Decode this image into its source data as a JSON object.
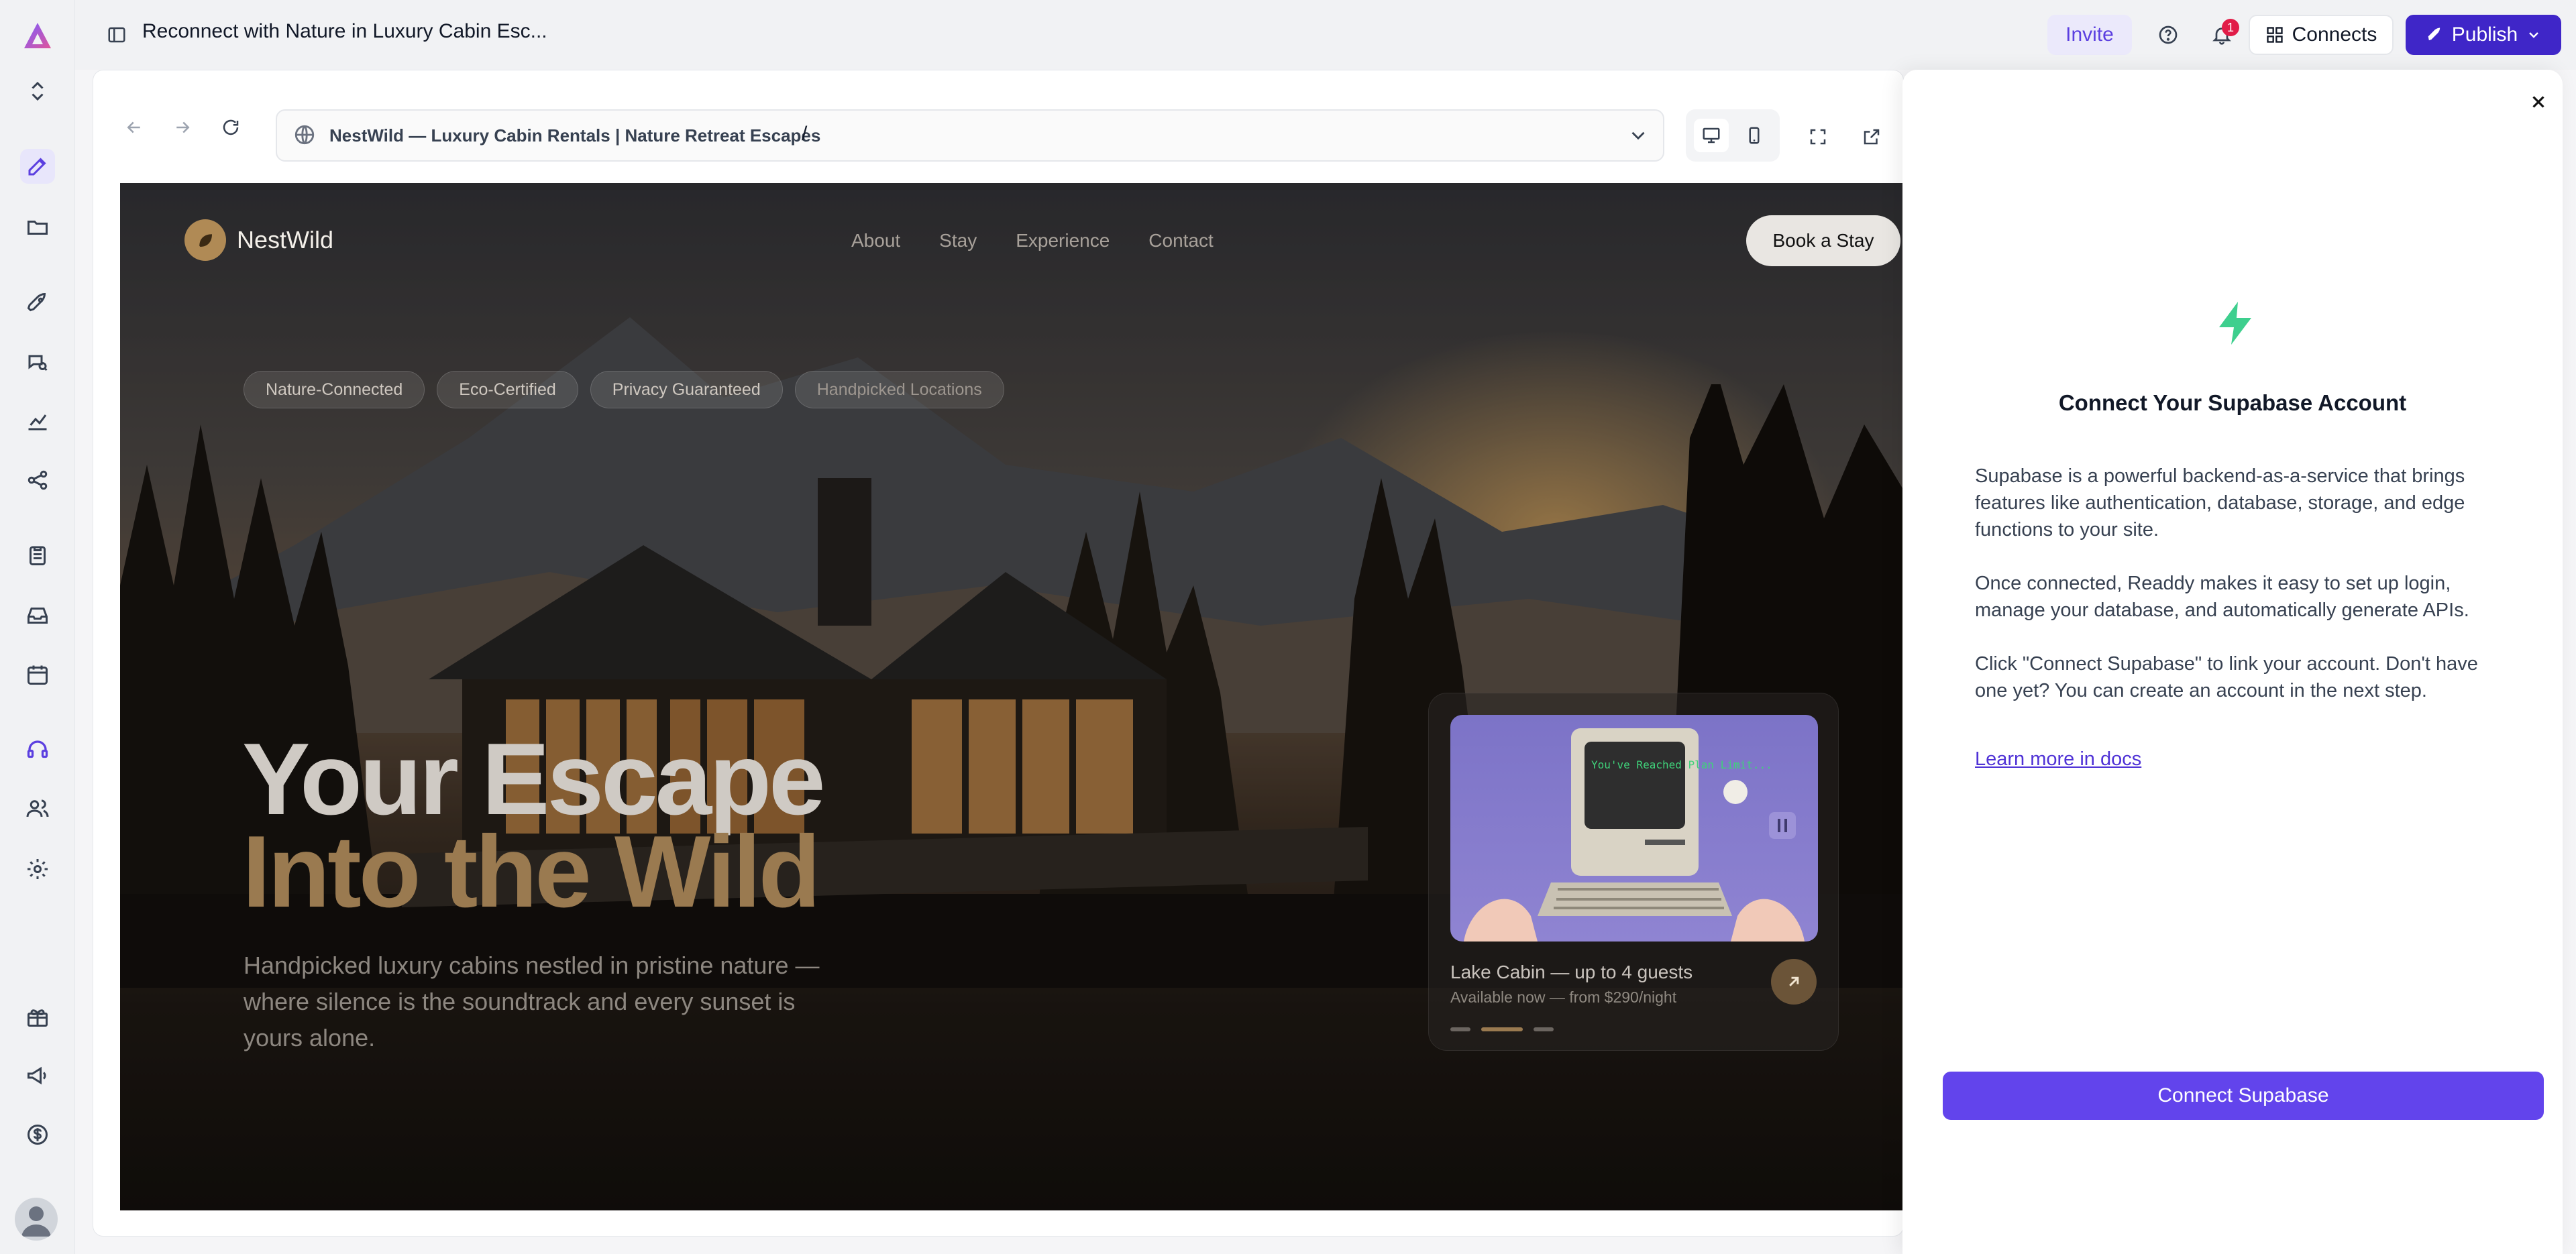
{
  "topbar": {
    "project_title": "Reconnect with Nature in Luxury Cabin Esc...",
    "invite_label": "Invite",
    "notification_count": "1",
    "connects_label": "Connects",
    "publish_label": "Publish"
  },
  "browser": {
    "site_title": "NestWild — Luxury Cabin Rentals | Nature Retreat Escapes",
    "path": "/"
  },
  "site": {
    "brand": "NestWild",
    "nav": [
      "About",
      "Stay",
      "Experience",
      "Contact"
    ],
    "cta": "Book a Stay",
    "chips": [
      "Nature-Connected",
      "Eco-Certified",
      "Privacy Guaranteed",
      "Handpicked Locations"
    ],
    "headline_line1": "Your Escape",
    "headline_line2": "Into the Wild",
    "subtext": "Handpicked luxury cabins nestled in pristine nature — where silence is the soundtrack and every sunset is yours alone.",
    "card": {
      "screen_text": "You've Reached Plan Limit...",
      "caption": "Lake Cabin — up to 4 guests",
      "subcaption": "Available now — from $290/night"
    }
  },
  "panel": {
    "title": "Connect Your Supabase Account",
    "paragraphs": [
      "Supabase is a powerful backend-as-a-service that brings features like authentication, database, storage, and edge functions to your site.",
      "Once connected, Readdy makes it easy to set up login, manage your database, and automatically generate APIs.",
      "Click \"Connect Supabase\" to link your account. Don't have one yet? You can create an account in the next step."
    ],
    "link_label": "Learn more in docs",
    "button_label": "Connect Supabase"
  },
  "colors": {
    "accent": "#6244ec",
    "publish": "#3f26c8",
    "supabase_green": "#3ecf8e",
    "headline_gold": "#9a7a50"
  }
}
